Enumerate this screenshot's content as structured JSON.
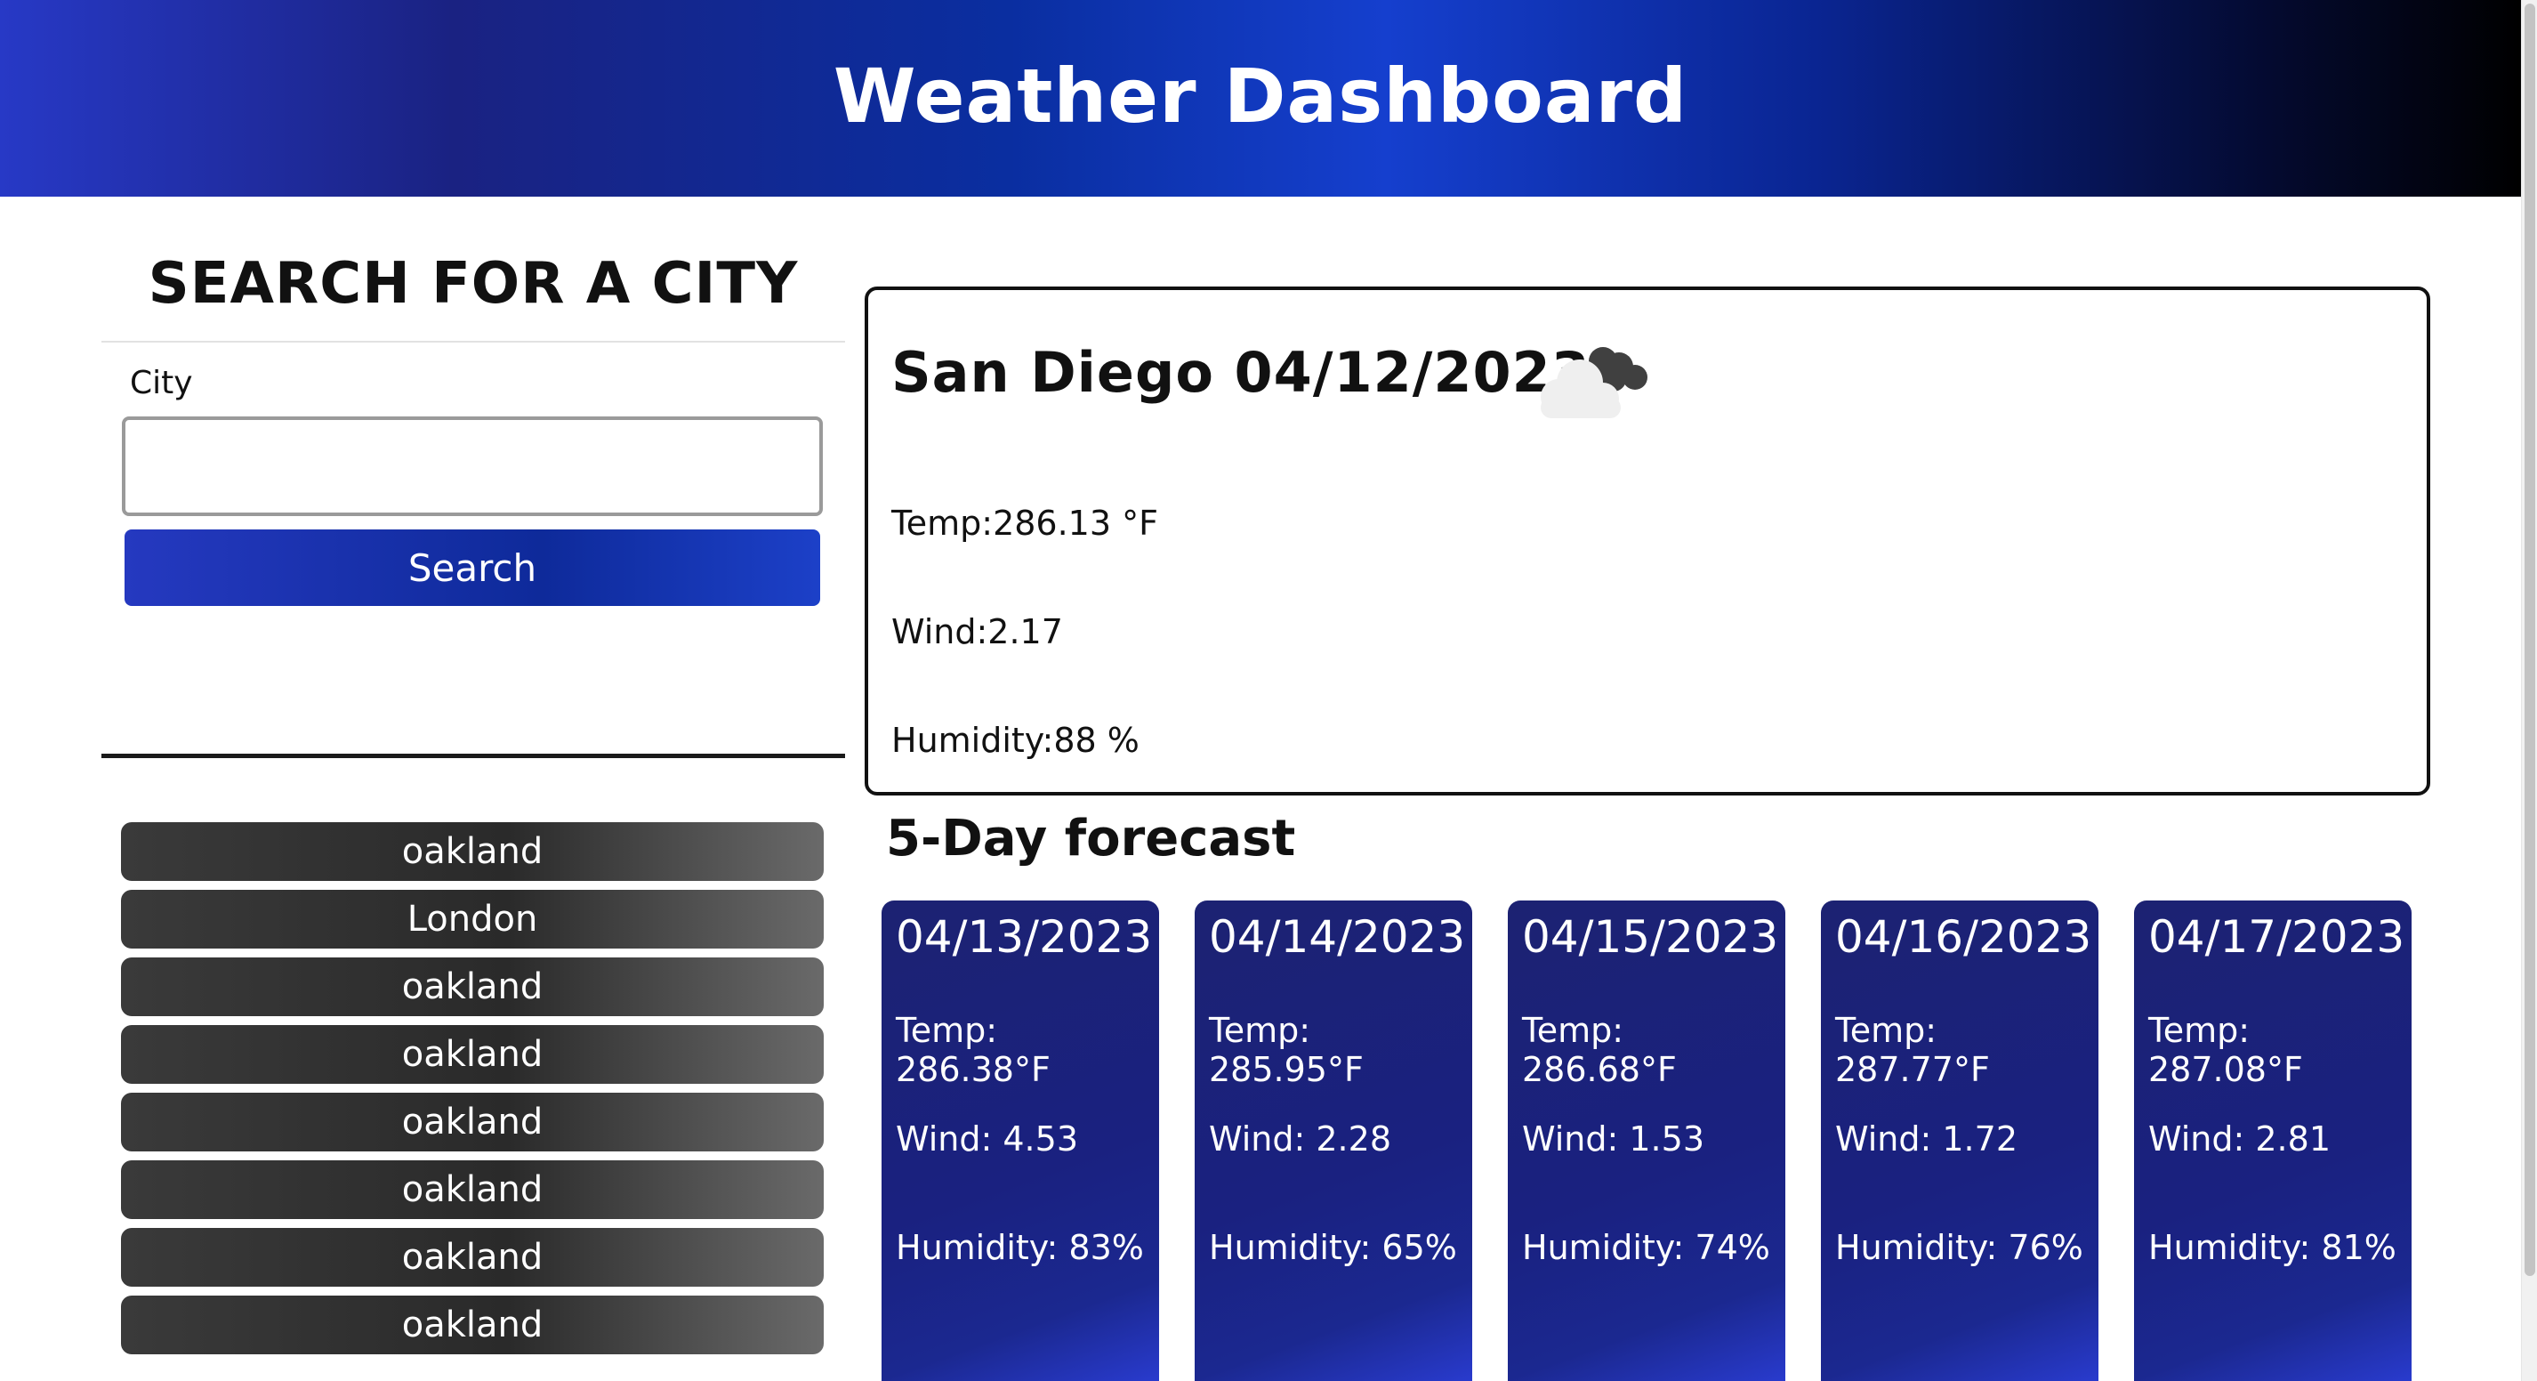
{
  "header": {
    "title": "Weather Dashboard"
  },
  "search": {
    "heading": "SEARCH FOR A CITY",
    "label": "City",
    "input_value": "",
    "button_label": "Search"
  },
  "history": [
    "oakland",
    "London",
    "oakland",
    "oakland",
    "oakland",
    "oakland",
    "oakland",
    "oakland"
  ],
  "current": {
    "title": "San Diego 04/12/2023",
    "icon": "cloudy-icon",
    "temp": "Temp:286.13 °F",
    "wind": "Wind:2.17",
    "humidity": "Humidity:88 %"
  },
  "forecast": {
    "heading": "5-Day forecast",
    "days": [
      {
        "date": "04/13/2023",
        "temp": "Temp: 286.38°F",
        "wind": "Wind: 4.53",
        "humidity": "Humidity: 83%"
      },
      {
        "date": "04/14/2023",
        "temp": "Temp: 285.95°F",
        "wind": "Wind: 2.28",
        "humidity": "Humidity: 65%"
      },
      {
        "date": "04/15/2023",
        "temp": "Temp: 286.68°F",
        "wind": "Wind: 1.53",
        "humidity": "Humidity: 74%"
      },
      {
        "date": "04/16/2023",
        "temp": "Temp: 287.77°F",
        "wind": "Wind: 1.72",
        "humidity": "Humidity: 76%"
      },
      {
        "date": "04/17/2023",
        "temp": "Temp: 287.08°F",
        "wind": "Wind: 2.81",
        "humidity": "Humidity: 81%"
      }
    ]
  },
  "colors": {
    "header_accent": "#153fce",
    "button": "#0e2a9a",
    "forecast_card": "#1a2180",
    "history_button": "#2a2a2a"
  }
}
